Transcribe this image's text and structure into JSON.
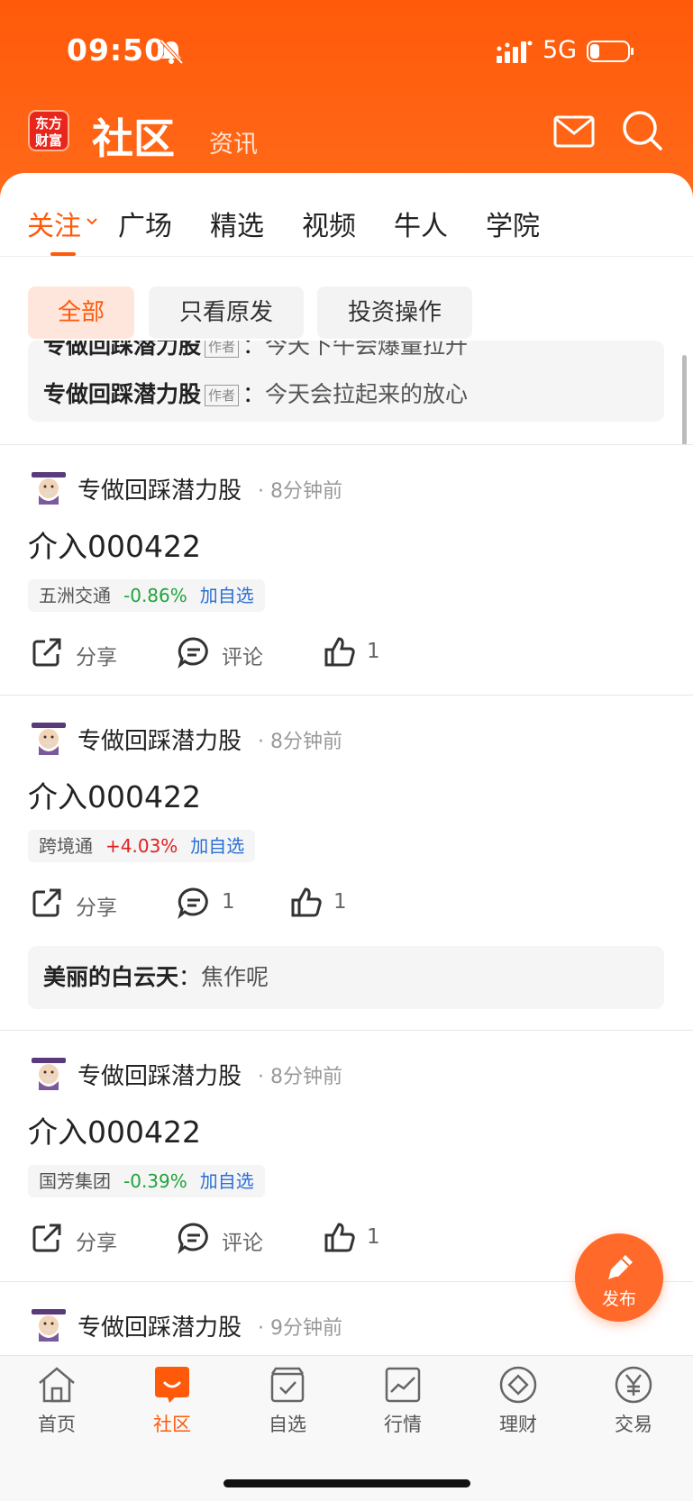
{
  "status_bar": {
    "time": "09:50",
    "network": "5G"
  },
  "header": {
    "logo_text": "东方财富",
    "title": "社区",
    "subnav": "资讯"
  },
  "tabs": [
    {
      "label": "关注",
      "active": true
    },
    {
      "label": "广场"
    },
    {
      "label": "精选"
    },
    {
      "label": "视频"
    },
    {
      "label": "牛人"
    },
    {
      "label": "学院"
    }
  ],
  "filters": [
    {
      "label": "全部",
      "active": true
    },
    {
      "label": "只看原发"
    },
    {
      "label": "投资操作"
    }
  ],
  "top_comment": {
    "partial_line": "专做回踩潜力股",
    "partial_text": "今天下午会爆量拉升",
    "author": "专做回踩潜力股",
    "author_tag": "作者",
    "text": "今天会拉起来的放心"
  },
  "posts": [
    {
      "author": "专做回踩潜力股",
      "time": "8分钟前",
      "title": "介入000422",
      "stock": {
        "name": "五洲交通",
        "change": "-0.86%",
        "direction": "down",
        "add": "加自选"
      },
      "share": "分享",
      "comment": "评论",
      "likes": "1"
    },
    {
      "author": "专做回踩潜力股",
      "time": "8分钟前",
      "title": "介入000422",
      "stock": {
        "name": "跨境通",
        "change": "+4.03%",
        "direction": "up",
        "add": "加自选"
      },
      "share": "分享",
      "comment": "1",
      "likes": "1",
      "reply": {
        "user": "美丽的白云天",
        "text": "焦作呢"
      }
    },
    {
      "author": "专做回踩潜力股",
      "time": "8分钟前",
      "title": "介入000422",
      "stock": {
        "name": "国芳集团",
        "change": "-0.39%",
        "direction": "down",
        "add": "加自选"
      },
      "share": "分享",
      "comment": "评论",
      "likes": "1"
    },
    {
      "author": "专做回踩潜力股",
      "time": "9分钟前"
    }
  ],
  "fab": {
    "label": "发布"
  },
  "bottom_nav": [
    {
      "label": "首页",
      "icon": "home-icon"
    },
    {
      "label": "社区",
      "icon": "community-icon",
      "active": true
    },
    {
      "label": "自选",
      "icon": "watchlist-icon"
    },
    {
      "label": "行情",
      "icon": "market-icon"
    },
    {
      "label": "理财",
      "icon": "wealth-icon"
    },
    {
      "label": "交易",
      "icon": "trade-icon"
    }
  ],
  "colors": {
    "brand": "#ff5a0a",
    "up": "#e02020",
    "down": "#1fa33a",
    "link": "#2a6fd6"
  }
}
